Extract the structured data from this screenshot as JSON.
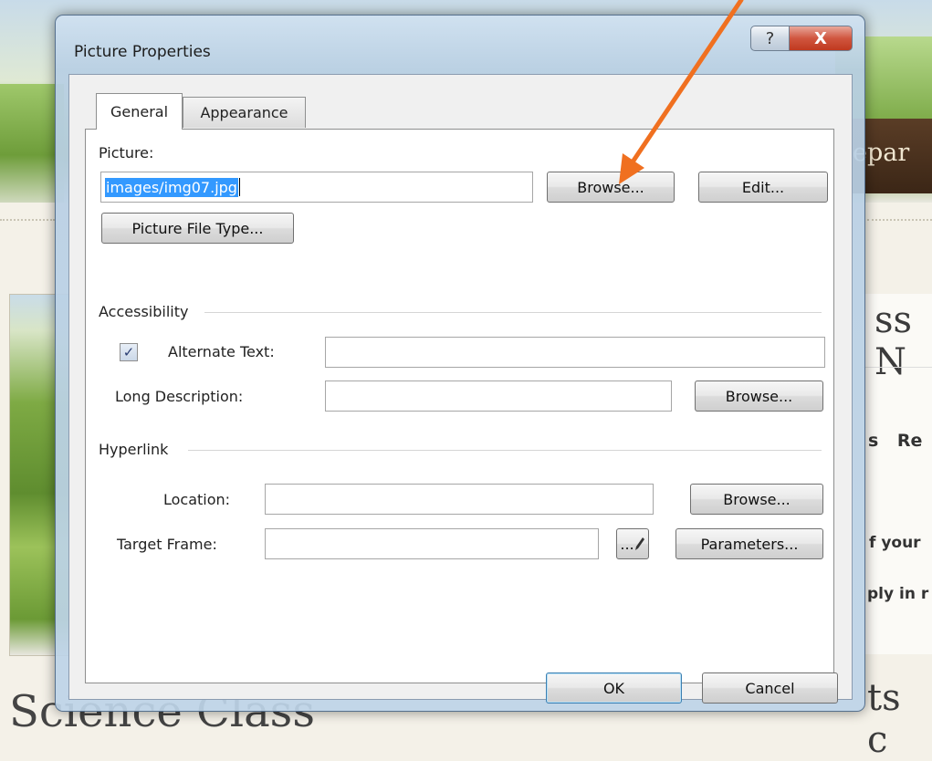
{
  "background": {
    "banner_text": "epar",
    "heading_right": "ss N",
    "nav_right": "s Re",
    "text_line1": "f your",
    "text_line2": "ply in r",
    "heading_bottom_right": "ts c",
    "heading_bottom": "Science Class"
  },
  "dialog": {
    "title": "Picture Properties",
    "help_label": "?",
    "close_label": "X",
    "tabs": [
      {
        "label": "General"
      },
      {
        "label": "Appearance"
      }
    ],
    "picture": {
      "label": "Picture:",
      "value": "images/img07.jpg",
      "browse_label": "Browse...",
      "edit_label": "Edit...",
      "file_type_label": "Picture File Type..."
    },
    "accessibility": {
      "group_label": "Accessibility",
      "alt_checkbox_mark": "✓",
      "alt_text_label": "Alternate Text:",
      "alt_text_value": "",
      "long_desc_label": "Long Description:",
      "long_desc_value": "",
      "browse_label": "Browse..."
    },
    "hyperlink": {
      "group_label": "Hyperlink",
      "location_label": "Location:",
      "location_value": "",
      "location_browse_label": "Browse...",
      "target_frame_label": "Target Frame:",
      "target_frame_value": "",
      "target_frame_picker_label": "...",
      "parameters_label": "Parameters..."
    },
    "ok_label": "OK",
    "cancel_label": "Cancel"
  },
  "colors": {
    "arrow": "#f07020",
    "selection": "#3399ff"
  }
}
